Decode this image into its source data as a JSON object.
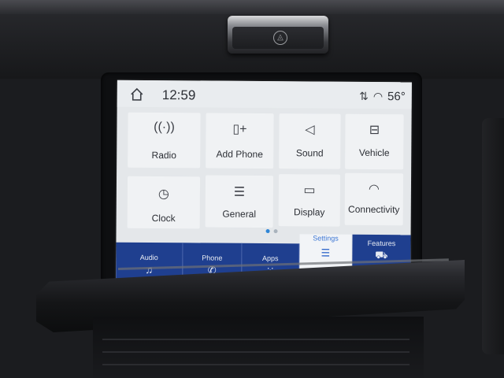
{
  "status": {
    "time": "12:59",
    "temperature": "56°"
  },
  "tiles": [
    {
      "label": "Radio",
      "icon": "radio-antenna-icon",
      "glyph": "((·))"
    },
    {
      "label": "Add Phone",
      "icon": "add-phone-icon",
      "glyph": "▯+"
    },
    {
      "label": "Sound",
      "icon": "speaker-icon",
      "glyph": "◁"
    },
    {
      "label": "Vehicle",
      "icon": "vehicle-settings-icon",
      "glyph": "⊟"
    },
    {
      "label": "Clock",
      "icon": "clock-icon",
      "glyph": "◷"
    },
    {
      "label": "General",
      "icon": "sliders-icon",
      "glyph": "☰"
    },
    {
      "label": "Display",
      "icon": "display-icon",
      "glyph": "▭"
    },
    {
      "label": "Connectivity",
      "icon": "wifi-icon",
      "glyph": "◠"
    }
  ],
  "nav": [
    {
      "label": "Audio",
      "icon": "music-note-icon",
      "glyph": "♫",
      "selected": false
    },
    {
      "label": "Phone",
      "icon": "phone-icon",
      "glyph": "✆",
      "selected": false
    },
    {
      "label": "Apps",
      "icon": "apps-grid-icon",
      "glyph": "⁙",
      "selected": false
    },
    {
      "label": "Settings",
      "icon": "settings-sliders-icon",
      "glyph": "☰",
      "selected": true
    },
    {
      "label": "Features",
      "icon": "truck-icon",
      "glyph": "⛟",
      "selected": false
    }
  ],
  "pagination": {
    "pages": 2,
    "current": 1
  }
}
